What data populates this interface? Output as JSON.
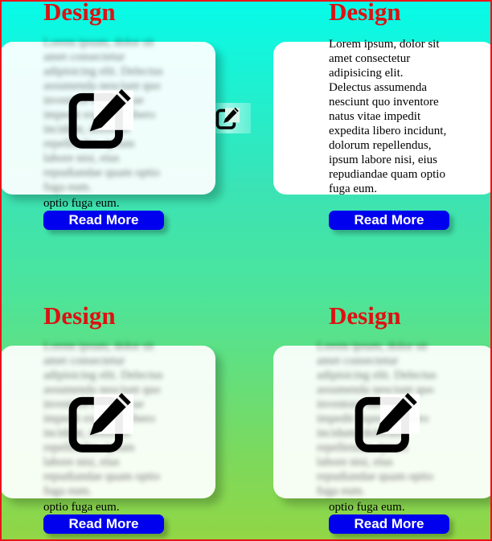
{
  "cards": [
    {
      "title": "Design",
      "text": "Lorem ipsum, dolor sit amet consectetur adipisicing elit. Delectus assumenda nesciunt quo inventore natus vitae impedit expedita libero incidunt, dolorum repellendus, ipsum labore nisi, eius repudiandae quam optio fuga eum.",
      "visible_tail": "optio fuga eum.",
      "button": "Read More",
      "icon": "edit-icon"
    },
    {
      "title": "Design",
      "text": "Lorem ipsum, dolor sit amet consectetur adipisicing elit. Delectus assumenda nesciunt quo inventore natus vitae impedit expedita libero incidunt, dolorum repellendus, ipsum labore nisi, eius repudiandae quam optio fuga eum.",
      "button": "Read More",
      "icon": "edit-icon"
    },
    {
      "title": "Design",
      "text": "Lorem ipsum, dolor sit amet consectetur adipisicing elit. Delectus assumenda nesciunt quo inventore natus vitae impedit expedita libero incidunt, dolorum repellendus, ipsum labore nisi, eius repudiandae quam optio fuga eum.",
      "visible_tail": "optio fuga eum.",
      "button": "Read More",
      "icon": "edit-icon"
    },
    {
      "title": "Design",
      "text": "Lorem ipsum, dolor sit amet consectetur adipisicing elit. Delectus assumenda nesciunt quo inventore natus vitae impedit expedita libero incidunt, dolorum repellendus, ipsum labore nisi, eius repudiandae quam optio fuga eum.",
      "visible_tail": "optio fuga eum.",
      "button": "Read More",
      "icon": "edit-icon"
    }
  ],
  "floating_icon": "edit-icon",
  "colors": {
    "title": "#dd1111",
    "button": "#0000ee",
    "border": "#e8141a",
    "gradient_top": "#06fbe9",
    "gradient_bottom": "#91d645"
  }
}
